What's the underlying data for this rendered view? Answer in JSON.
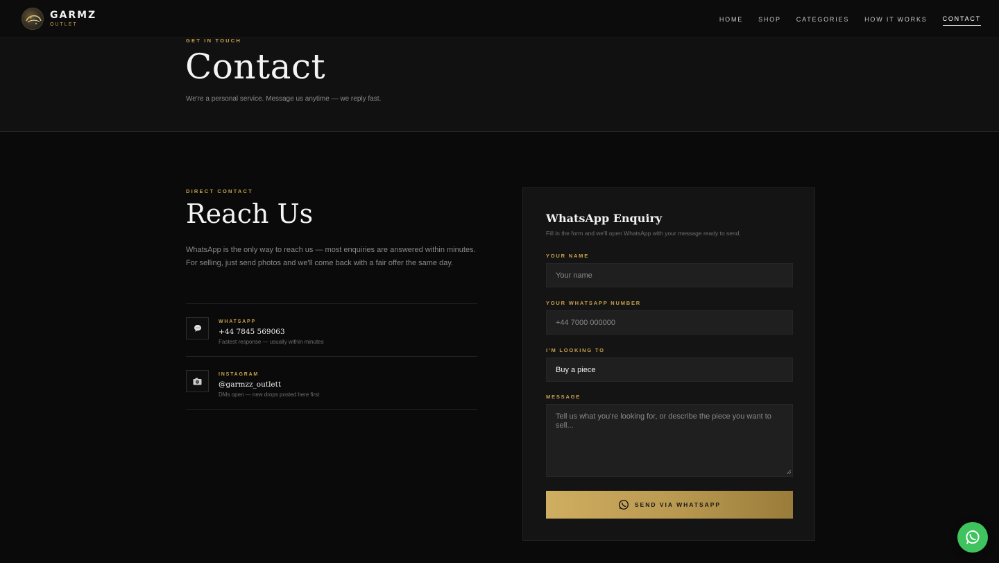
{
  "brand": {
    "name": "GARMZ",
    "tagline": "OUTLET"
  },
  "nav": {
    "items": [
      {
        "label": "HOME"
      },
      {
        "label": "SHOP"
      },
      {
        "label": "CATEGORIES"
      },
      {
        "label": "HOW IT WORKS"
      },
      {
        "label": "CONTACT",
        "active": true
      }
    ]
  },
  "hero": {
    "eyebrow": "GET IN TOUCH",
    "title": "Contact",
    "subtitle": "We're a personal service. Message us anytime — we reply fast."
  },
  "direct": {
    "eyebrow": "DIRECT CONTACT",
    "title": "Reach Us",
    "body": "WhatsApp is the only way to reach us — most enquiries are answered within minutes. For selling, just send photos and we'll come back with a fair offer the same day.",
    "items": [
      {
        "icon": "speech-bubble-icon",
        "label": "WHATSAPP",
        "value": "+44 7845 569063",
        "note": "Fastest response — usually within minutes"
      },
      {
        "icon": "camera-icon",
        "label": "INSTAGRAM",
        "value": "@garmzz_outlett",
        "note": "DMs open — new drops posted here first"
      }
    ]
  },
  "form": {
    "title": "WhatsApp Enquiry",
    "subtitle": "Fill in the form and we'll open WhatsApp with your message ready to send.",
    "name_label": "YOUR NAME",
    "name_placeholder": "Your name",
    "phone_label": "YOUR WHATSAPP NUMBER",
    "phone_placeholder": "+44 7000 000000",
    "intent_label": "I'M LOOKING TO",
    "intent_value": "Buy a piece",
    "message_label": "MESSAGE",
    "message_placeholder": "Tell us what you're looking for, or describe the piece you want to sell...",
    "submit_label": "SEND VIA WHATSAPP"
  },
  "colors": {
    "accent": "#c9a24e",
    "background": "#0a0a0a",
    "whatsapp": "#3ec35e"
  }
}
